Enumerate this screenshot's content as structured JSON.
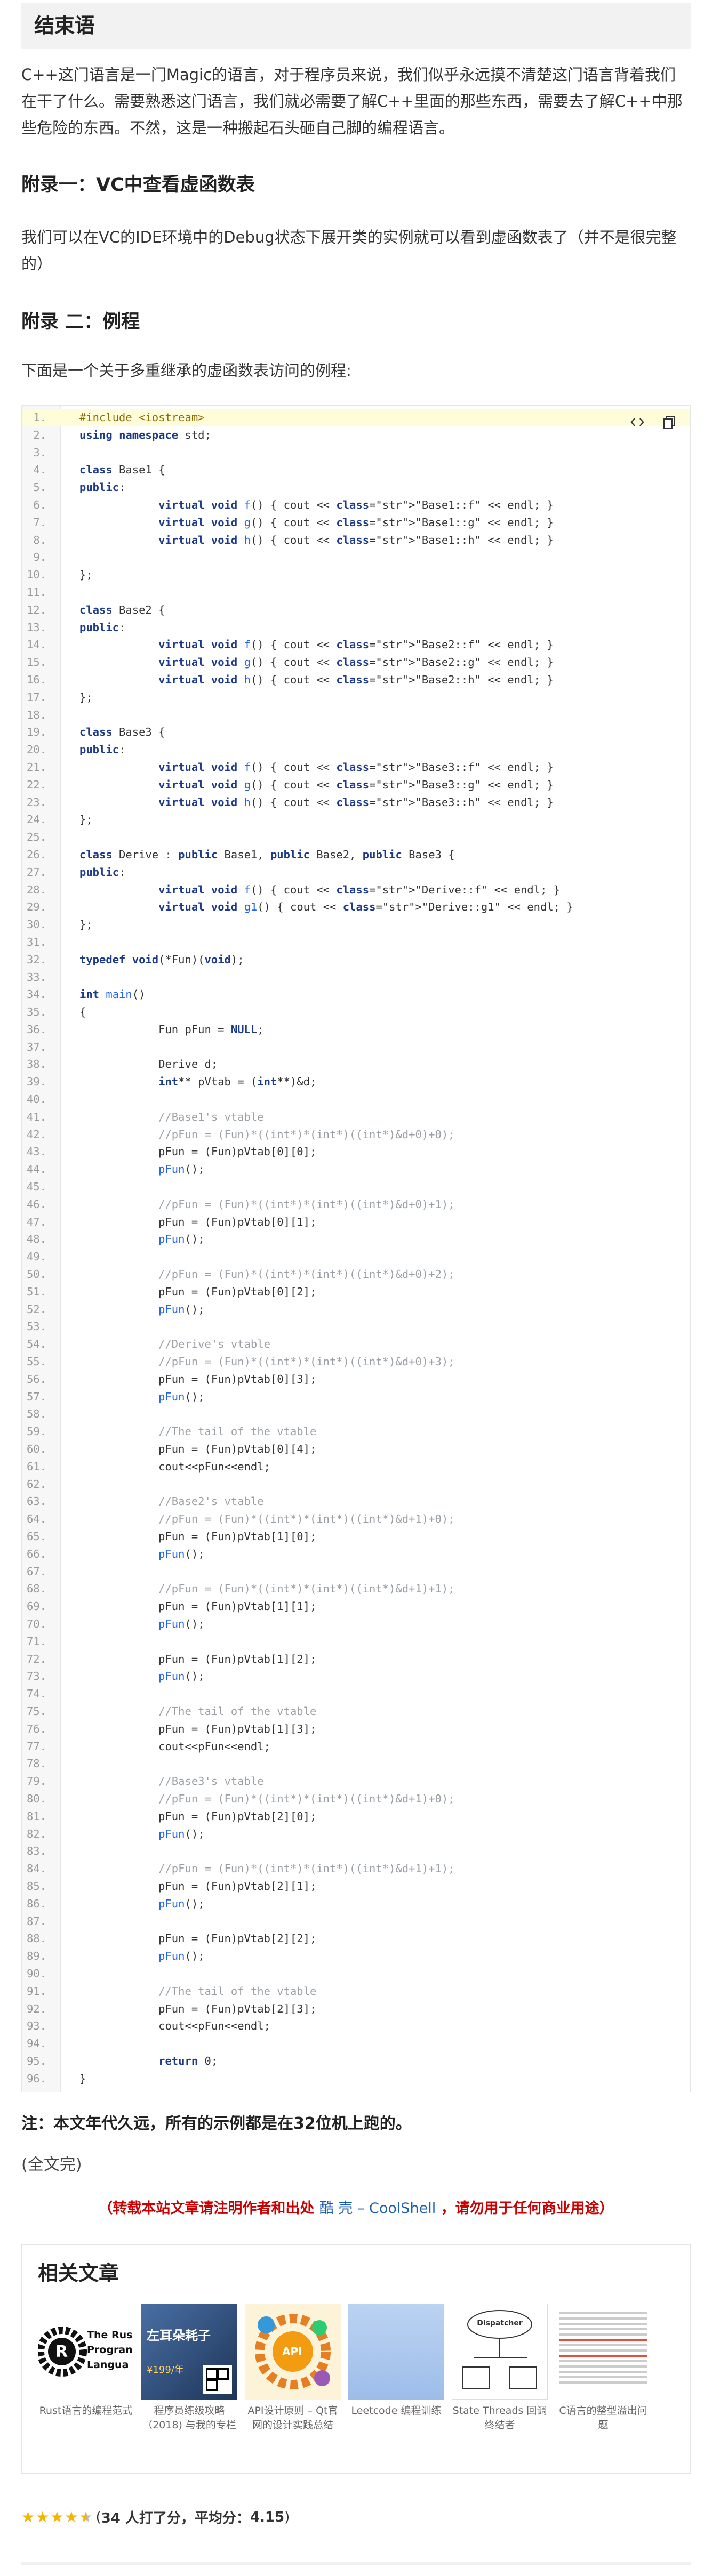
{
  "section": {
    "title": "结束语",
    "intro": "C++这门语言是一门Magic的语言，对于程序员来说，我们似乎永远摸不清楚这门语言背着我们在干了什么。需要熟悉这门语言，我们就必需要了解C++里面的那些东西，需要去了解C++中那些危险的东西。不然，这是一种搬起石头砸自己脚的编程语言。"
  },
  "appendix1": {
    "title": "附录一：VC中查看虚函数表",
    "body": "我们可以在VC的IDE环境中的Debug状态下展开类的实例就可以看到虚函数表了（并不是很完整的）"
  },
  "appendix2": {
    "title": "附录 二：例程",
    "intro": "下面是一个关于多重继承的虚函数表访问的例程:"
  },
  "code": {
    "lines": [
      "#include <iostream>",
      "using namespace std;",
      "",
      "class Base1 {",
      "public:",
      "            virtual void f() { cout << \"Base1::f\" << endl; }",
      "            virtual void g() { cout << \"Base1::g\" << endl; }",
      "            virtual void h() { cout << \"Base1::h\" << endl; }",
      "",
      "};",
      "",
      "class Base2 {",
      "public:",
      "            virtual void f() { cout << \"Base2::f\" << endl; }",
      "            virtual void g() { cout << \"Base2::g\" << endl; }",
      "            virtual void h() { cout << \"Base2::h\" << endl; }",
      "};",
      "",
      "class Base3 {",
      "public:",
      "            virtual void f() { cout << \"Base3::f\" << endl; }",
      "            virtual void g() { cout << \"Base3::g\" << endl; }",
      "            virtual void h() { cout << \"Base3::h\" << endl; }",
      "};",
      "",
      "class Derive : public Base1, public Base2, public Base3 {",
      "public:",
      "            virtual void f() { cout << \"Derive::f\" << endl; }",
      "            virtual void g1() { cout << \"Derive::g1\" << endl; }",
      "};",
      "",
      "typedef void(*Fun)(void);",
      "",
      "int main()",
      "{",
      "            Fun pFun = NULL;",
      "",
      "            Derive d;",
      "            int** pVtab = (int**)&d;",
      "",
      "            //Base1's vtable",
      "            //pFun = (Fun)*((int*)*(int*)((int*)&d+0)+0);",
      "            pFun = (Fun)pVtab[0][0];",
      "            pFun();",
      "",
      "            //pFun = (Fun)*((int*)*(int*)((int*)&d+0)+1);",
      "            pFun = (Fun)pVtab[0][1];",
      "            pFun();",
      "",
      "            //pFun = (Fun)*((int*)*(int*)((int*)&d+0)+2);",
      "            pFun = (Fun)pVtab[0][2];",
      "            pFun();",
      "",
      "            //Derive's vtable",
      "            //pFun = (Fun)*((int*)*(int*)((int*)&d+0)+3);",
      "            pFun = (Fun)pVtab[0][3];",
      "            pFun();",
      "",
      "            //The tail of the vtable",
      "            pFun = (Fun)pVtab[0][4];",
      "            cout<<pFun<<endl;",
      "",
      "            //Base2's vtable",
      "            //pFun = (Fun)*((int*)*(int*)((int*)&d+1)+0);",
      "            pFun = (Fun)pVtab[1][0];",
      "            pFun();",
      "",
      "            //pFun = (Fun)*((int*)*(int*)((int*)&d+1)+1);",
      "            pFun = (Fun)pVtab[1][1];",
      "            pFun();",
      "",
      "            pFun = (Fun)pVtab[1][2];",
      "            pFun();",
      "",
      "            //The tail of the vtable",
      "            pFun = (Fun)pVtab[1][3];",
      "            cout<<pFun<<endl;",
      "",
      "            //Base3's vtable",
      "            //pFun = (Fun)*((int*)*(int*)((int*)&d+1)+0);",
      "            pFun = (Fun)pVtab[2][0];",
      "            pFun();",
      "",
      "            //pFun = (Fun)*((int*)*(int*)((int*)&d+1)+1);",
      "            pFun = (Fun)pVtab[2][1];",
      "            pFun();",
      "",
      "            pFun = (Fun)pVtab[2][2];",
      "            pFun();",
      "",
      "            //The tail of the vtable",
      "            pFun = (Fun)pVtab[2][3];",
      "            cout<<pFun<<endl;",
      "",
      "            return 0;",
      "}"
    ]
  },
  "note": "注：本文年代久远，所有的示例都是在32位机上跑的。",
  "end_text": "(全文完)",
  "repost": {
    "prefix": "（转载本站文章请注明作者和出处 ",
    "link": "酷 壳 – CoolShell",
    "suffix": " ，请勿用于任何商业用途）"
  },
  "related": {
    "title": "相关文章",
    "items": [
      {
        "label": "Rust语言的编程范式",
        "thumb_text": "The Rus Progran Langua"
      },
      {
        "label": "程序员练级攻略（2018) 与我的专栏",
        "thumb_text": "左耳朵耗子",
        "thumb_price": "¥199/年"
      },
      {
        "label": "API设计原则 – Qt官网的设计实践总结",
        "thumb_text": "API"
      },
      {
        "label": "Leetcode 编程训练",
        "thumb_text": ""
      },
      {
        "label": "State Threads 回调终结者",
        "thumb_text": "Dispatcher"
      },
      {
        "label": "C语言的整型溢出问题",
        "thumb_text": ""
      }
    ]
  },
  "rating": {
    "value": 4.15,
    "prefix": "(",
    "count_text": "34 人打了分，平均分：",
    "score": "4.15",
    "suffix": " )"
  },
  "colors": {
    "accent": "#cc0000",
    "link": "#1a5fb4",
    "star": "#f4b400"
  }
}
